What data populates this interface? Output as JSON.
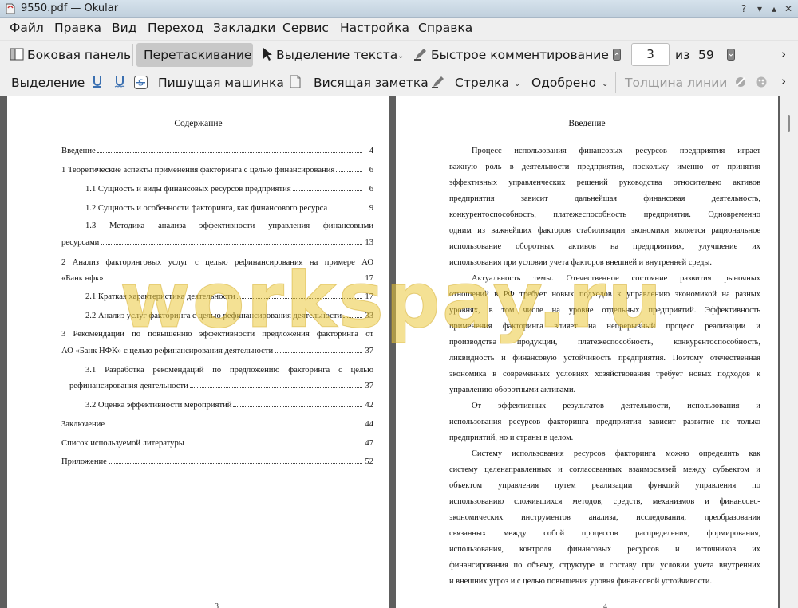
{
  "window": {
    "title": "9550.pdf  — Okular"
  },
  "menu": [
    "Файл",
    "Правка",
    "Вид",
    "Переход",
    "Закладки",
    "Сервис",
    "Настройка",
    "Справка"
  ],
  "toolbar1": {
    "sidebar": "Боковая панель",
    "drag": "Перетаскивание",
    "text_select": "Выделение текста",
    "quick_annot": "Быстрое комментирование",
    "page_current": "3",
    "page_of": "из",
    "page_total": "59"
  },
  "toolbar2": {
    "selection": "Выделение",
    "typewriter": "Пишущая машинка",
    "note": "Висящая заметка",
    "arrow": "Стрелка",
    "approved": "Одобрено",
    "line_width": "Толщина линии"
  },
  "left_page": {
    "heading": "Содержание",
    "page_number": "3",
    "toc": [
      {
        "text": "Введение",
        "page": "4"
      },
      {
        "text": "1 Теоретические аспекты применения факторинга с целью финансирования",
        "page": "6"
      },
      {
        "text": "1.1 Сущность и виды финансовых ресурсов предприятия",
        "page": "6"
      },
      {
        "text": "1.2 Сущность и особенности факторинга, как финансового ресурса",
        "page": "9"
      },
      {
        "text": "1.3   Методика   анализа   эффективности   управления   финансовыми",
        "text2": "ресурсами",
        "page": "13"
      },
      {
        "text": "2  Анализ  факторинговых  услуг  с  целью  рефинансирования  на  примере  АО",
        "text2": "«Банк нфк»",
        "page": "17"
      },
      {
        "text": "2.1 Краткая характеристика деятельности",
        "page": "17"
      },
      {
        "text": "2.2 Анализ услуг факторинга с целью рефинансирования деятельности",
        "page": "33"
      },
      {
        "text": "3  Рекомендации  по  повышению  эффективности  предложения  факторинга  от",
        "text2": "АО «Банк НФК» с целью рефинансирования деятельности",
        "page": "37"
      },
      {
        "text": "3.1   Разработка   рекомендаций   по   предложению   факторинга   с   целью",
        "text2": "рефинансирования деятельности",
        "page": "37"
      },
      {
        "text": "3.2 Оценка эффективности мероприятий",
        "page": "42"
      },
      {
        "text": "Заключение",
        "page": "44"
      },
      {
        "text": "Список используемой литературы",
        "page": "47"
      },
      {
        "text": "Приложение",
        "page": "52"
      }
    ]
  },
  "right_page": {
    "heading": "Введение",
    "page_number": "4",
    "lines": [
      "Процесс  использования  финансовых  ресурсов  предприятия  играет",
      "важную роль в деятельности предприятия, поскольку именно от принятия",
      "эффективных управленческих решений руководства относительно активов",
      "предприятия       зависит       дальнейшая       финансовая       деятельность,",
      "конкурентоспособность,  платежеспособность  предприятия.  Одновременно",
      "одним из важнейших факторов стабилизации экономики является рациональное",
      "использование  оборотных  активов  на  предприятиях,  улучшение  их",
      "использования при условии учета факторов внешней и внутренней среды.",
      "Актуальность  темы.  Отечественное  состояние  развития  рыночных",
      "отношений в РФ требует новых подходов к управлению экономикой на разных",
      "уровнях,  в  том  числе  на  уровне  отдельных  предприятий.  Эффективность",
      "применения  факторинга  влияет  на  непрерывный  процесс  реализации  и",
      "производства         продукции,         платежеспособность,         конкурентоспособность,",
      "ликвидность и финансовую устойчивость предприятия. Поэтому отечественная",
      "экономика в современных условиях хозяйствования требует новых подходов к",
      "управлению оборотными активами.",
      "От      эффективных      результатов      деятельности,      использования      и",
      "использования ресурсов факторинга предприятия зависит развитие не только",
      "предприятий, но и страны в целом.",
      "Систему  использования  ресурсов  факторинга  можно  определить  как",
      "систему целенаправленных и согласованных взаимосвязей между субъектом и",
      "объектом    управления    путем    реализации    функций    управления    по",
      "использованию сложившихся методов, средств, механизмов и финансово-",
      "экономических   инструментов   анализа,   исследования,   преобразования",
      "связанных     между     собой     процессов     распределения,     формирования,",
      "использования,     контроля     финансовых     ресурсов     и     источников     их",
      "финансирования по объему, структуре и составу при условии учета внутренних",
      "и внешних угроз и с целью повышения уровня финансовой устойчивости."
    ]
  },
  "watermark": "workspay.ru"
}
